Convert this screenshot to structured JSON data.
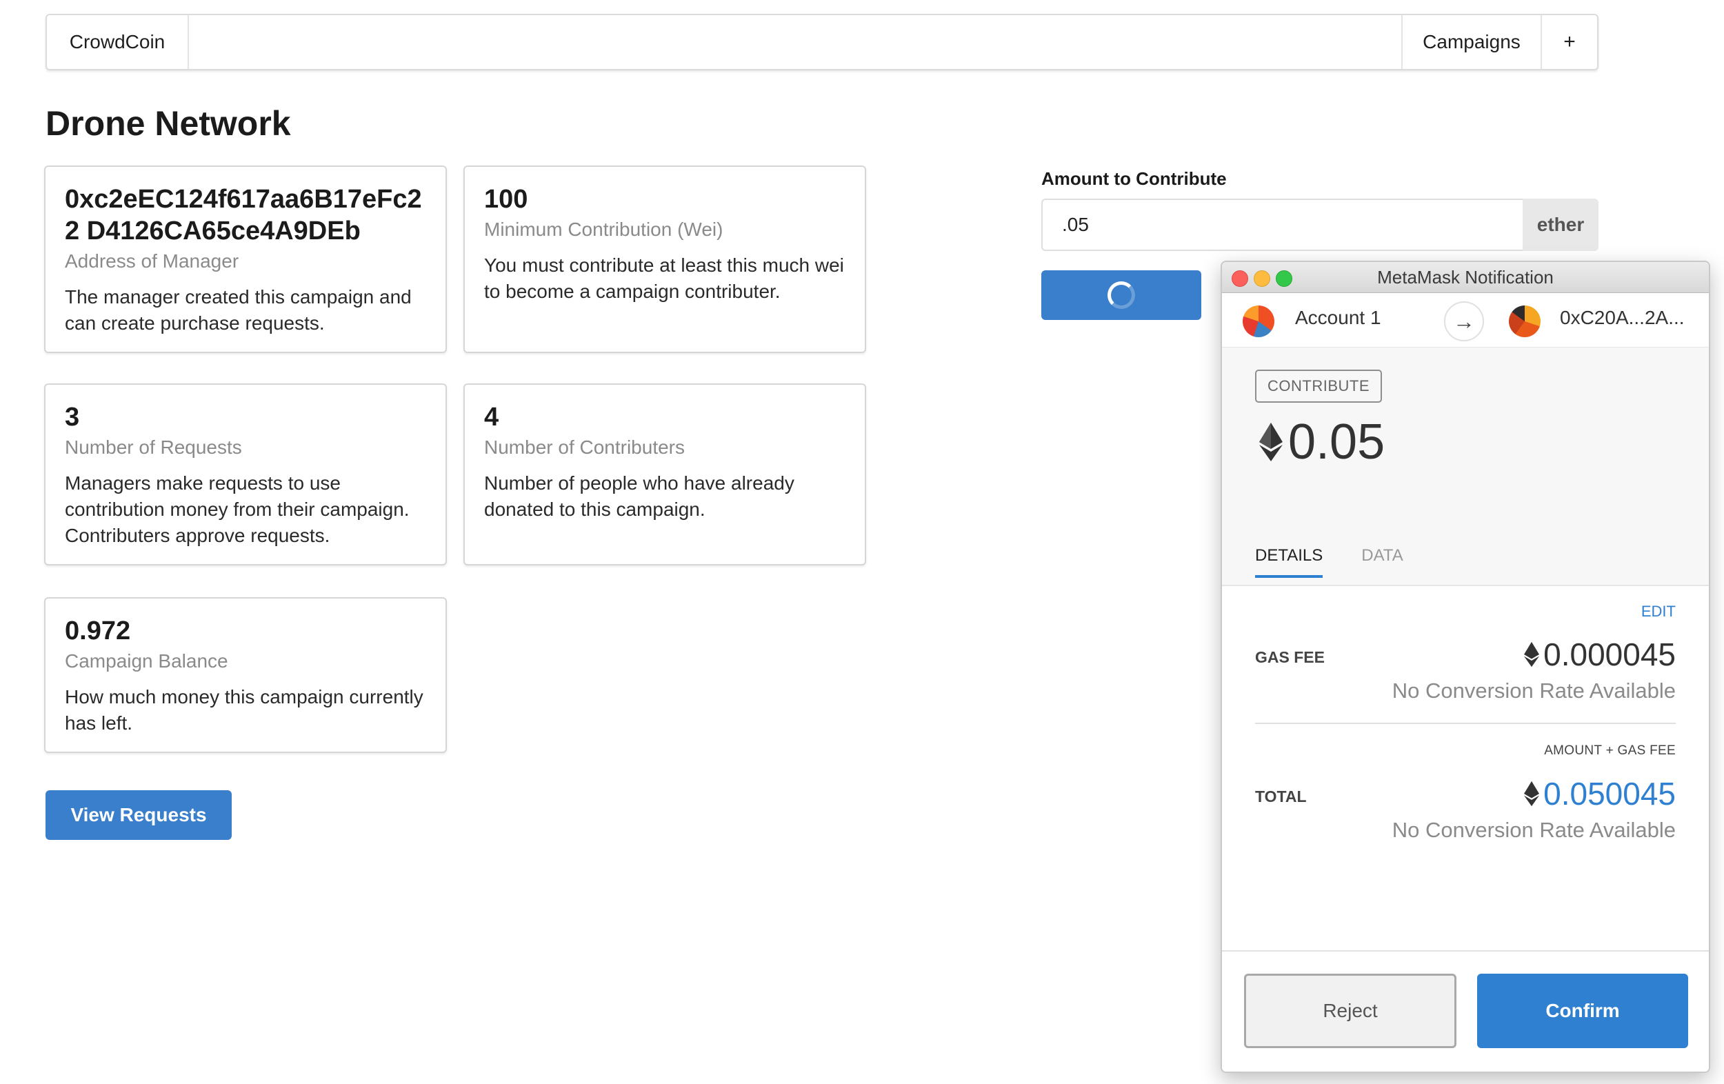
{
  "menu": {
    "brand": "CrowdCoin",
    "campaigns": "Campaigns",
    "add": "+"
  },
  "page": {
    "title": "Drone Network"
  },
  "cards": [
    {
      "header": "0xc2eEC124f617aa6B17eFc22 D4126CA65ce4A9DEb",
      "meta": "Address of Manager",
      "description": "The manager created this campaign and can create purchase requests."
    },
    {
      "header": "100",
      "meta": "Minimum Contribution (Wei)",
      "description": "You must contribute at least this much wei to become a campaign contributer."
    },
    {
      "header": "3",
      "meta": "Number of Requests",
      "description": "Managers make requests to use contribution money from their campaign. Contributers approve requests."
    },
    {
      "header": "4",
      "meta": "Number of Contributers",
      "description": "Number of people who have already donated to this campaign."
    },
    {
      "header": "0.972",
      "meta": "Campaign Balance",
      "description": "How much money this campaign currently has left."
    }
  ],
  "view_requests": "View Requests",
  "contribute_form": {
    "label": "Amount to Contribute",
    "value": ".05",
    "unit": "ether",
    "loading": true
  },
  "metamask": {
    "window_title": "MetaMask Notification",
    "from_account": "Account 1",
    "to_account": "0xC20A...2A...",
    "action_badge": "CONTRIBUTE",
    "amount": "0.05",
    "tabs": [
      "DETAILS",
      "DATA"
    ],
    "active_tab": "DETAILS",
    "edit": "EDIT",
    "gas_fee_label": "GAS FEE",
    "gas_fee_value": "0.000045",
    "gas_fee_conversion": "No Conversion Rate Available",
    "total_caption": "AMOUNT + GAS FEE",
    "total_label": "TOTAL",
    "total_value": "0.050045",
    "total_conversion": "No Conversion Rate Available",
    "reject": "Reject",
    "confirm": "Confirm",
    "icons": {
      "eth": "ethereum-icon",
      "arrow": "arrow-right-icon"
    }
  },
  "colors": {
    "primary": "#3a7fcb",
    "metamask_blue": "#2f80d1"
  }
}
